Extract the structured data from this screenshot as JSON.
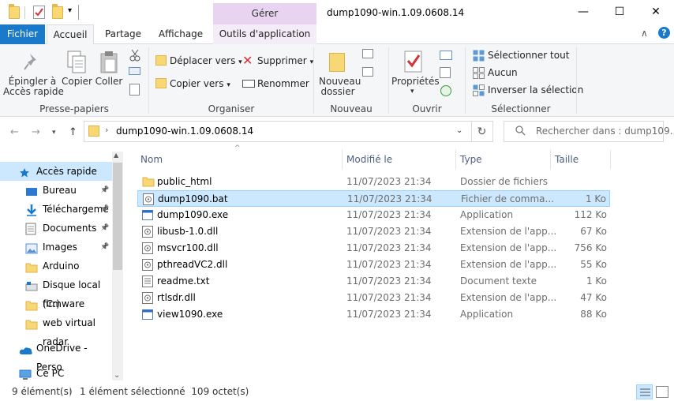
{
  "titlebar": {
    "gerer_label": "Gérer",
    "title": "dump1090-win.1.09.0608.14",
    "minimize": "—",
    "maximize": "☐",
    "close": "✕"
  },
  "tabs": {
    "fichier": "Fichier",
    "accueil": "Accueil",
    "partage": "Partage",
    "affichage": "Affichage",
    "outils": "Outils d'application",
    "collapse": "∧",
    "help": "?"
  },
  "ribbon": {
    "presse_papiers": {
      "label": "Presse-papiers",
      "epingler": "Épingler à\nAccès rapide",
      "copier": "Copier",
      "coller": "Coller"
    },
    "organiser": {
      "label": "Organiser",
      "deplacer": "Déplacer vers",
      "copier_vers": "Copier vers",
      "supprimer": "Supprimer",
      "renommer": "Renommer"
    },
    "nouveau": {
      "label": "Nouveau",
      "nouveau_dossier": "Nouveau\ndossier"
    },
    "ouvrir": {
      "label": "Ouvrir",
      "proprietes": "Propriétés"
    },
    "selectionner": {
      "label": "Sélectionner",
      "tout": "Sélectionner tout",
      "aucun": "Aucun",
      "inverser": "Inverser la sélection"
    }
  },
  "address": {
    "path": "dump1090-win.1.09.0608.14",
    "search_placeholder": "Rechercher dans : dump109..."
  },
  "nav_pane": [
    {
      "label": "Accès rapide",
      "icon": "star-icon",
      "pinned": false,
      "selected": true
    },
    {
      "label": "Bureau",
      "icon": "desktop-icon",
      "pinned": true,
      "selected": false
    },
    {
      "label": "Téléchargeme",
      "icon": "download-icon",
      "pinned": true,
      "selected": false
    },
    {
      "label": "Documents",
      "icon": "documents-icon",
      "pinned": true,
      "selected": false
    },
    {
      "label": "Images",
      "icon": "images-icon",
      "pinned": true,
      "selected": false
    },
    {
      "label": "Arduino",
      "icon": "folder-icon",
      "pinned": false,
      "selected": false
    },
    {
      "label": "Disque local (C:)",
      "icon": "drive-icon",
      "pinned": false,
      "selected": false
    },
    {
      "label": "firmware",
      "icon": "folder-icon",
      "pinned": false,
      "selected": false
    },
    {
      "label": "web virtual radar",
      "icon": "folder-icon",
      "pinned": false,
      "selected": false
    },
    {
      "label": "OneDrive - Perso",
      "icon": "cloud-icon",
      "pinned": false,
      "selected": false
    },
    {
      "label": "Ce PC",
      "icon": "computer-icon",
      "pinned": false,
      "selected": false
    }
  ],
  "columns": {
    "nom": "Nom",
    "modifie": "Modifié le",
    "type": "Type",
    "taille": "Taille"
  },
  "files": [
    {
      "name": "public_html",
      "date": "11/07/2023 21:34",
      "type": "Dossier de fichiers",
      "size": "",
      "icon": "folder-icon",
      "selected": false
    },
    {
      "name": "dump1090.bat",
      "date": "11/07/2023 21:34",
      "type": "Fichier de comma...",
      "size": "1 Ko",
      "icon": "batch-file-icon",
      "selected": true
    },
    {
      "name": "dump1090.exe",
      "date": "11/07/2023 21:34",
      "type": "Application",
      "size": "112 Ko",
      "icon": "exe-icon",
      "selected": false
    },
    {
      "name": "libusb-1.0.dll",
      "date": "11/07/2023 21:34",
      "type": "Extension de l'app...",
      "size": "67 Ko",
      "icon": "dll-icon",
      "selected": false
    },
    {
      "name": "msvcr100.dll",
      "date": "11/07/2023 21:34",
      "type": "Extension de l'app...",
      "size": "756 Ko",
      "icon": "dll-icon",
      "selected": false
    },
    {
      "name": "pthreadVC2.dll",
      "date": "11/07/2023 21:34",
      "type": "Extension de l'app...",
      "size": "55 Ko",
      "icon": "dll-icon",
      "selected": false
    },
    {
      "name": "readme.txt",
      "date": "11/07/2023 21:34",
      "type": "Document texte",
      "size": "1 Ko",
      "icon": "text-file-icon",
      "selected": false
    },
    {
      "name": "rtlsdr.dll",
      "date": "11/07/2023 21:34",
      "type": "Extension de l'app...",
      "size": "47 Ko",
      "icon": "dll-icon",
      "selected": false
    },
    {
      "name": "view1090.exe",
      "date": "11/07/2023 21:34",
      "type": "Application",
      "size": "88 Ko",
      "icon": "exe-icon",
      "selected": false
    }
  ],
  "status": {
    "count": "9 élément(s)",
    "selection": "1 élément sélectionné  109 octet(s)"
  },
  "colors": {
    "accent": "#1979ca",
    "selection": "#cce8ff",
    "manage_tab": "#e8d4f0"
  }
}
